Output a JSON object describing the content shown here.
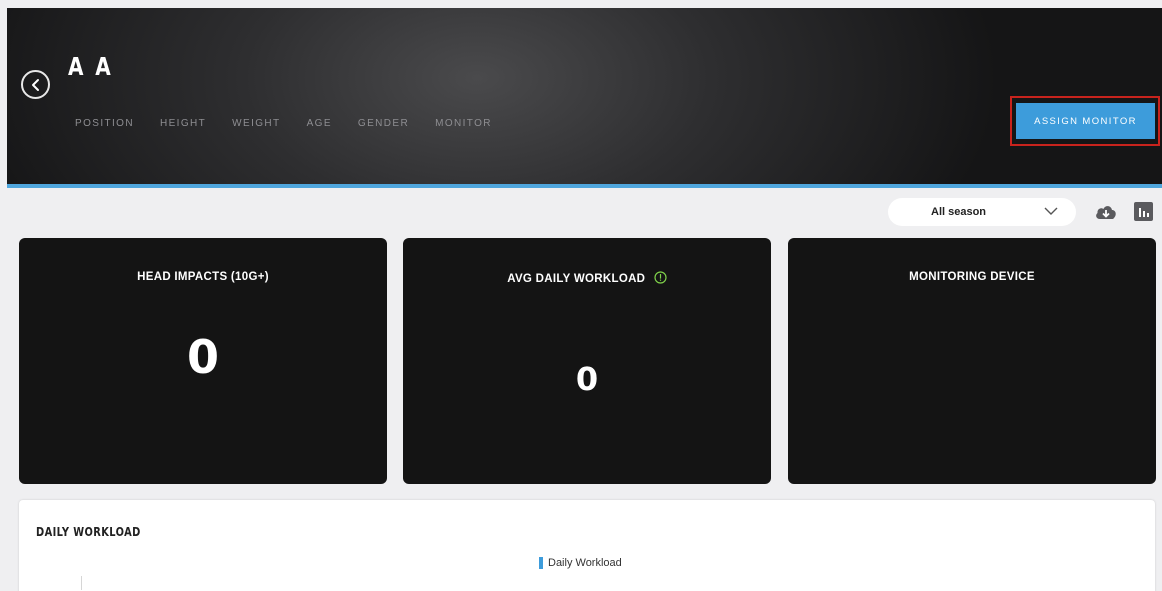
{
  "header": {
    "player_name": "A A",
    "meta_labels": [
      "POSITION",
      "HEIGHT",
      "WEIGHT",
      "AGE",
      "GENDER",
      "MONITOR"
    ],
    "assign_button_label": "ASSIGN MONITOR",
    "accent_color": "#4fa6dd",
    "highlight_color": "#c8231d"
  },
  "toolbar": {
    "season_selected": "All season",
    "icons": [
      "cloud-download-icon",
      "bar-chart-icon"
    ]
  },
  "cards": [
    {
      "title": "HEAD IMPACTS (10G+)",
      "value": "0"
    },
    {
      "title": "AVG DAILY WORKLOAD",
      "value": "0",
      "icon": "info-icon"
    },
    {
      "title": "MONITORING DEVICE",
      "value": ""
    }
  ],
  "daily_workload": {
    "title": "DAILY WORKLOAD",
    "legend_label": "Daily Workload",
    "legend_color": "#3d9cdb"
  }
}
